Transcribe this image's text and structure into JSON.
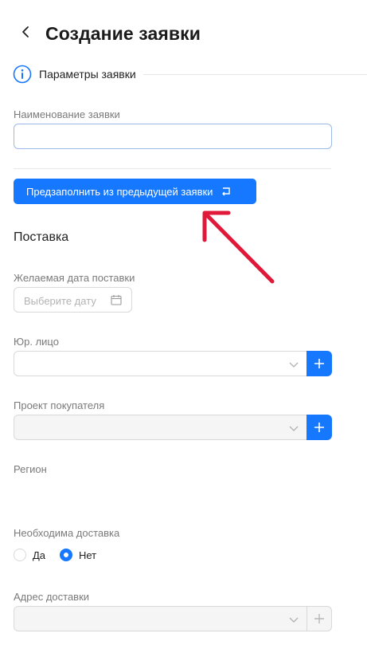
{
  "header": {
    "title": "Создание заявки"
  },
  "step": {
    "label": "Параметры заявки"
  },
  "form": {
    "name_label": "Наименование заявки",
    "name_value": "",
    "prefill_button": "Предзаполнить из предыдущей заявки",
    "section_title": "Поставка",
    "date_label": "Желаемая дата поставки",
    "date_placeholder": "Выберите дату",
    "legal_entity_label": "Юр. лицо",
    "buyer_project_label": "Проект покупателя",
    "region_label": "Регион",
    "delivery_label": "Необходима доставка",
    "delivery_options": [
      "Да",
      "Нет"
    ],
    "delivery_selected": "Нет",
    "address_label": "Адрес доставки"
  },
  "colors": {
    "accent": "#1677ff",
    "annotation_arrow": "#e0193a"
  },
  "icons": [
    "back-arrow-icon",
    "info-icon",
    "undo-icon",
    "calendar-icon",
    "chevron-down-icon",
    "plus-icon"
  ]
}
